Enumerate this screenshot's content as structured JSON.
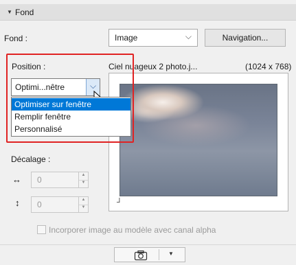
{
  "section": {
    "title": "Fond",
    "toggle_glyph": "▼"
  },
  "fond": {
    "label": "Fond :",
    "select_value": "Image",
    "navigation_label": "Navigation..."
  },
  "position": {
    "label": "Position :",
    "select_value": "Optimi...nêtre",
    "options": [
      "Optimiser sur fenêtre",
      "Remplir fenêtre",
      "Personnalisé"
    ],
    "selected_index": 0
  },
  "image_info": {
    "filename": "Ciel nuageux 2 photo.j...",
    "dimensions": "(1024 x 768)"
  },
  "offset": {
    "label": "Décalage :",
    "x_value": "0",
    "y_value": "0"
  },
  "alpha_checkbox": {
    "label": "Incorporer image au modèle avec canal alpha",
    "checked": false
  },
  "icons": {
    "horizontal": "↔",
    "vertical": "↕",
    "chevron": "⌵",
    "camera": "camera-icon"
  },
  "colors": {
    "highlight": "#0078d7",
    "annotation": "#e02222"
  }
}
